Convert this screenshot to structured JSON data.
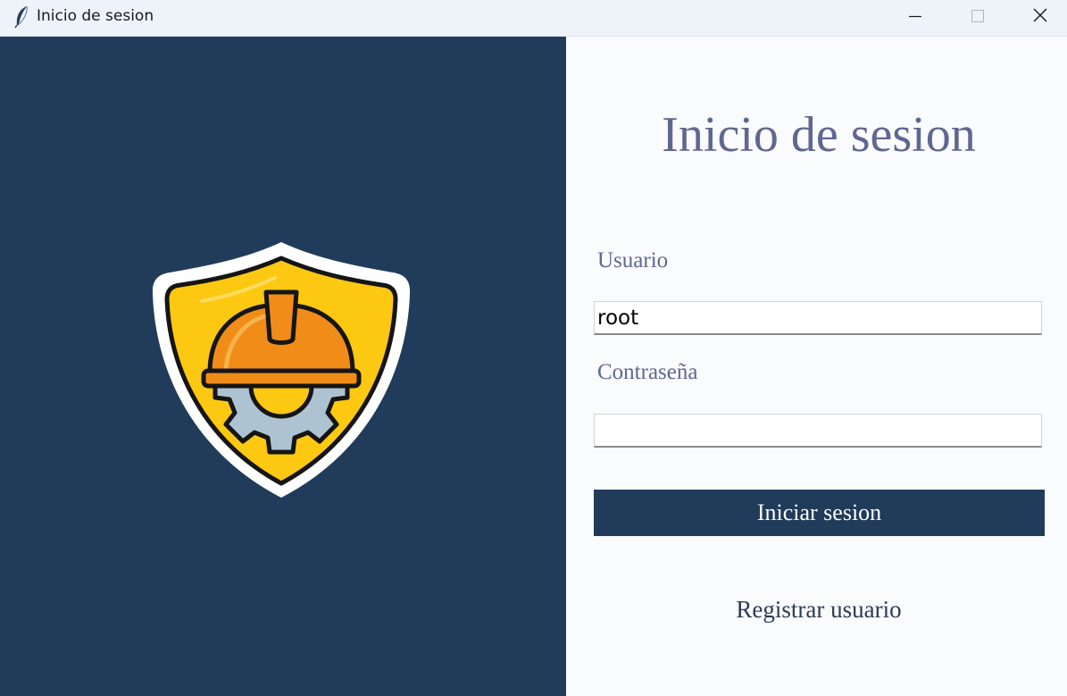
{
  "window": {
    "title": "Inicio de sesion",
    "icon": "feather-icon",
    "controls": [
      "minimize-icon",
      "maximize-icon",
      "close-icon"
    ]
  },
  "left_panel": {
    "background": "#203c5a",
    "logo": "safety-shield-hardhat-gear-icon"
  },
  "login_form": {
    "title": "Inicio de sesion",
    "username_label": "Usuario",
    "username_value": "root",
    "password_label": "Contraseña",
    "password_value": "",
    "submit_label": "Iniciar sesion",
    "register_label": "Registrar usuario"
  },
  "colors": {
    "accent": "#203c5a",
    "title_text": "#5f6791",
    "logo_yellow": "#fdc812",
    "logo_orange": "#f08c17",
    "gear_gray": "#aec3d1"
  }
}
